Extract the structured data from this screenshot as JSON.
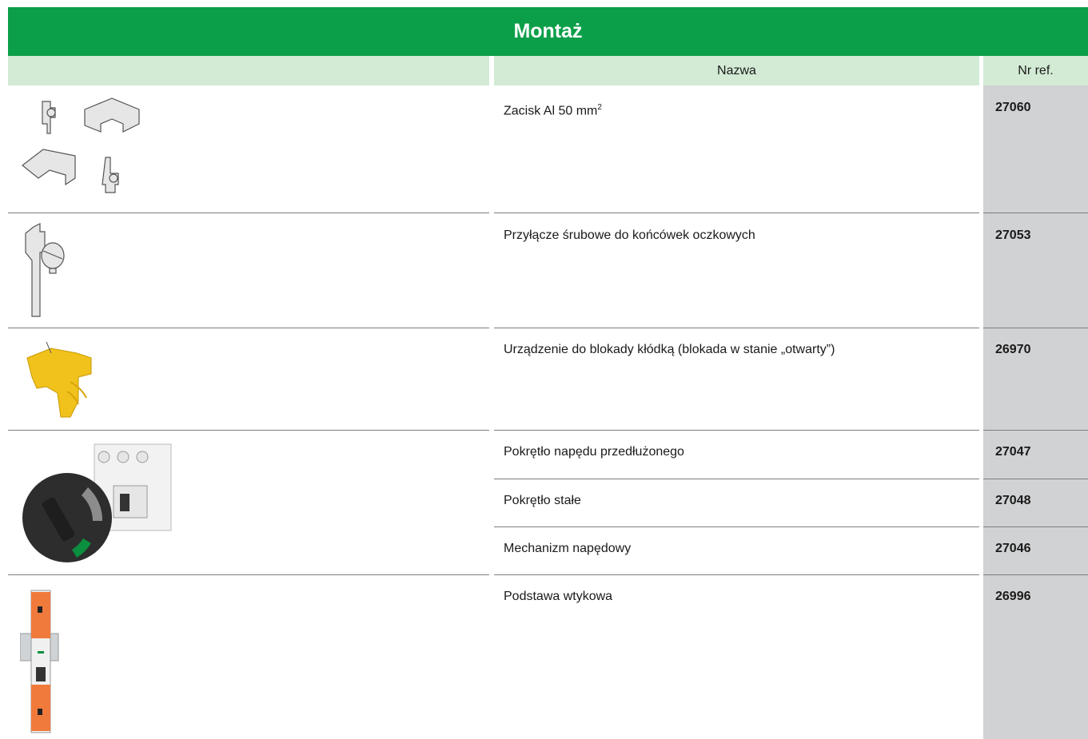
{
  "title": "Montaż",
  "headers": {
    "image": "",
    "name": "Nazwa",
    "ref": "Nr ref."
  },
  "rows": [
    {
      "name": "Zacisk Al 50 mm",
      "name_sup": "2",
      "ref": "27060"
    },
    {
      "name": "Przyłącze śrubowe do końcówek oczkowych",
      "ref": "27053"
    },
    {
      "name": "Urządzenie do blokady kłódką (blokada w stanie „otwarty”)",
      "ref": "26970"
    },
    {
      "name": "Pokrętło napędu przedłużonego",
      "ref": "27047"
    },
    {
      "name": "Pokrętło stałe",
      "ref": "27048"
    },
    {
      "name": "Mechanizm napędowy",
      "ref": "27046"
    },
    {
      "name": "Podstawa wtykowa",
      "ref": "26996"
    }
  ],
  "colors": {
    "banner": "#0c9f49",
    "header": "#d3ebd5",
    "ref_column": "#d1d2d4"
  }
}
